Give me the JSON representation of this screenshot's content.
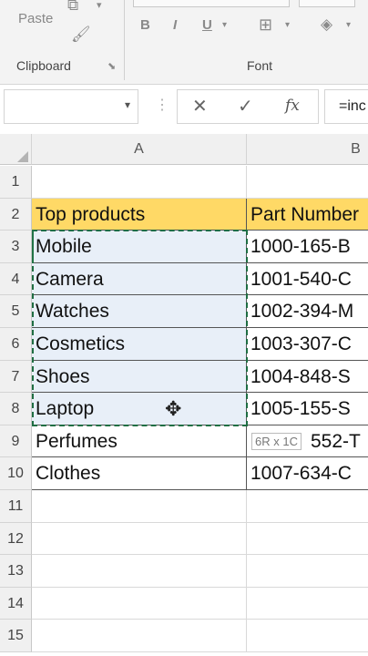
{
  "ribbon": {
    "paste_label": "Paste",
    "clipboard_label": "Clipboard",
    "font_label": "Font",
    "bold": "B",
    "italic": "I",
    "underline": "U",
    "fx": "fx",
    "formula_value": "=inc"
  },
  "columns": [
    "A",
    "B"
  ],
  "rows": [
    {
      "num": "1",
      "a": "",
      "b": ""
    },
    {
      "num": "2",
      "a": "Top products",
      "b": "Part Number"
    },
    {
      "num": "3",
      "a": "Mobile",
      "b": "1000-165-B"
    },
    {
      "num": "4",
      "a": "Camera",
      "b": "1001-540-C"
    },
    {
      "num": "5",
      "a": "Watches",
      "b": "1002-394-M"
    },
    {
      "num": "6",
      "a": "Cosmetics",
      "b": "1003-307-C"
    },
    {
      "num": "7",
      "a": "Shoes",
      "b": "1004-848-S"
    },
    {
      "num": "8",
      "a": "Laptop",
      "b": "1005-155-S"
    },
    {
      "num": "9",
      "a": "Perfumes",
      "b": "552-T"
    },
    {
      "num": "10",
      "a": "Clothes",
      "b": "1007-634-C"
    },
    {
      "num": "11",
      "a": "",
      "b": ""
    },
    {
      "num": "12",
      "a": "",
      "b": ""
    },
    {
      "num": "13",
      "a": "",
      "b": ""
    },
    {
      "num": "14",
      "a": "",
      "b": ""
    },
    {
      "num": "15",
      "a": "",
      "b": ""
    }
  ],
  "selection_tooltip": "6R x 1C",
  "colors": {
    "header_fill": "#ffd966",
    "selection_fill": "#e8eff8",
    "marquee": "#1f6e43"
  }
}
